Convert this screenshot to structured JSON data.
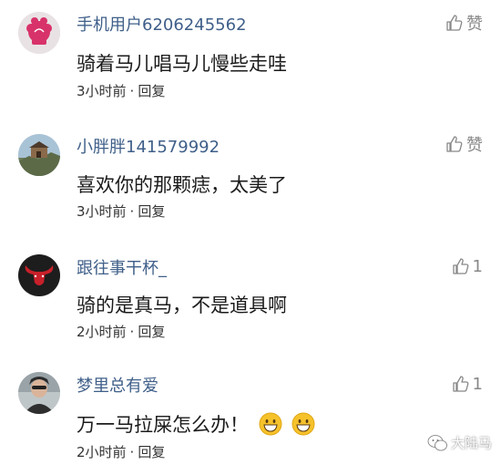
{
  "comments": [
    {
      "user": "手机用户6206245562",
      "text": "骑着马儿唱马儿慢些走哇",
      "time": "3小时前",
      "reply": "回复",
      "like_label": "赞",
      "avatar_icon": "pink-flower-avatar-icon"
    },
    {
      "user": "小胖胖141579992",
      "text": "喜欢你的那颗痣，太美了",
      "time": "3小时前",
      "reply": "回复",
      "like_label": "赞",
      "avatar_icon": "great-wall-avatar-icon"
    },
    {
      "user": "跟往事干杯_",
      "text": "骑的是真马，不是道具啊",
      "time": "2小时前",
      "reply": "回复",
      "like_label": "1",
      "avatar_icon": "bull-avatar-icon"
    },
    {
      "user": "梦里总有爱",
      "text": "万一马拉屎怎么办！",
      "time": "2小时前",
      "reply": "回复",
      "like_label": "1",
      "avatar_icon": "person-photo-avatar-icon",
      "emojis": [
        "grinning-face-emoji",
        "grinning-face-emoji"
      ]
    }
  ],
  "separator": "·",
  "watermark": {
    "text": "大陆马",
    "icon": "wechat-icon"
  },
  "colors": {
    "username": "#3f5f89",
    "text": "#1b1b1b",
    "meta": "#333333",
    "like": "#888888"
  }
}
